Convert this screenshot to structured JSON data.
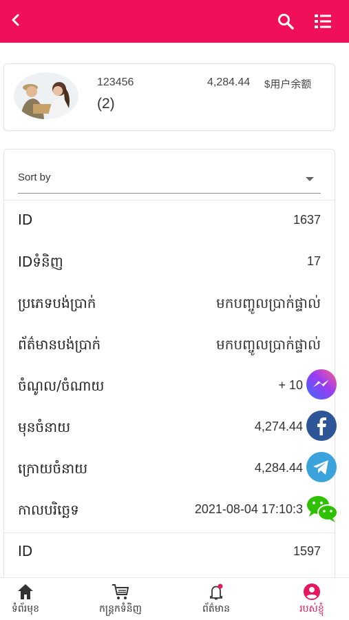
{
  "header": {
    "back_icon": "chevron-left-icon",
    "search_icon": "search-icon",
    "menu_icon": "list-icon",
    "bg_color": "#f0105a"
  },
  "user": {
    "id": "123456",
    "count": "(2)",
    "balance": "4,284.44",
    "balance_label": "$用户余额"
  },
  "sort": {
    "label": "Sort by"
  },
  "records": [
    {
      "label": "ID",
      "value": "1637"
    },
    {
      "label": "IDទំនិញ",
      "value": "17"
    },
    {
      "label": "ប្រភេទបង់ប្រាក់",
      "value": "មកបញ្ចូលប្រាក់ផ្ទាល់"
    },
    {
      "label": "ព័ត៌មានបង់ប្រាក់",
      "value": "មកបញ្ចូលប្រាក់ផ្ទាល់"
    },
    {
      "label": "ចំណូល/ចំណាយ",
      "value": "+ 10"
    },
    {
      "label": "មុនចំនាយ",
      "value": "4,274.44"
    },
    {
      "label": "ក្រោយចំនាយ",
      "value": "4,284.44"
    },
    {
      "label": "កាលបរិច្ឆេទ",
      "value": "2021-08-04 17:10:3"
    }
  ],
  "next_record": {
    "label": "ID",
    "value": "1597"
  },
  "floating_icons": [
    "messenger-icon",
    "facebook-icon",
    "telegram-icon",
    "wechat-icon"
  ],
  "tabs": [
    {
      "label": "ទំព័រមុខ",
      "icon": "home-icon"
    },
    {
      "label": "កន្ត្រកទំនិញ",
      "icon": "cart-icon"
    },
    {
      "label": "ព័ត៌មាន",
      "icon": "bell-icon"
    },
    {
      "label": "របស់ខ្ញុំ",
      "icon": "user-icon"
    }
  ],
  "accent_color": "#e8155f"
}
